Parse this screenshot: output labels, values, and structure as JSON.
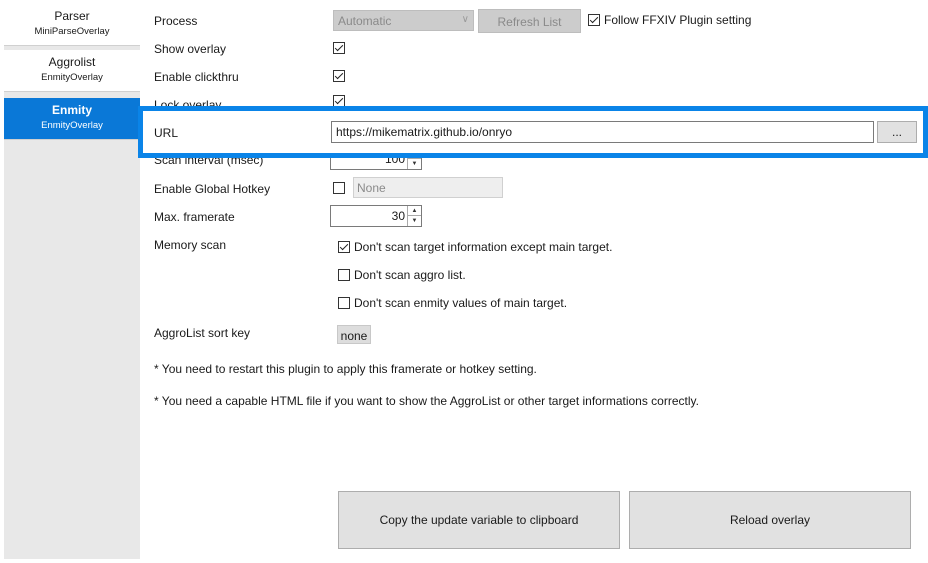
{
  "sidebar": {
    "tabs": [
      {
        "title": "Parser",
        "subtitle": "MiniParseOverlay"
      },
      {
        "title": "Aggrolist",
        "subtitle": "EnmityOverlay"
      },
      {
        "title": "Enmity",
        "subtitle": "EnmityOverlay",
        "active": true
      }
    ]
  },
  "settings": {
    "process_label": "Process",
    "process_value": "Automatic",
    "refresh_label": "Refresh List",
    "follow_label": "Follow FFXIV Plugin setting",
    "show_overlay_label": "Show overlay",
    "clickthru_label": "Enable clickthru",
    "lock_label": "Lock overlay",
    "url_label": "URL",
    "url_value": "https://mikematrix.github.io/onryo",
    "browse_label": "...",
    "scan_interval_label": "Scan interval (msec)",
    "scan_interval_value": "100",
    "hotkey_label": "Enable Global Hotkey",
    "hotkey_value": "None",
    "framerate_label": "Max. framerate",
    "framerate_value": "30",
    "memscan_label": "Memory scan",
    "memscan_opt1": "Don't scan target information except main target.",
    "memscan_opt2": "Don't scan aggro list.",
    "memscan_opt3": "Don't scan enmity values of main target.",
    "sortkey_label": "AggroList sort key",
    "sortkey_value": "none",
    "note1": "* You need to restart this plugin to apply this framerate or hotkey setting.",
    "note2": "* You need a capable HTML file if you want to show the AggroList or other target informations correctly.",
    "copy_btn": "Copy the update variable to clipboard",
    "reload_btn": "Reload overlay"
  },
  "colors": {
    "accent": "#0a78d7",
    "highlight": "#0a84e8"
  }
}
